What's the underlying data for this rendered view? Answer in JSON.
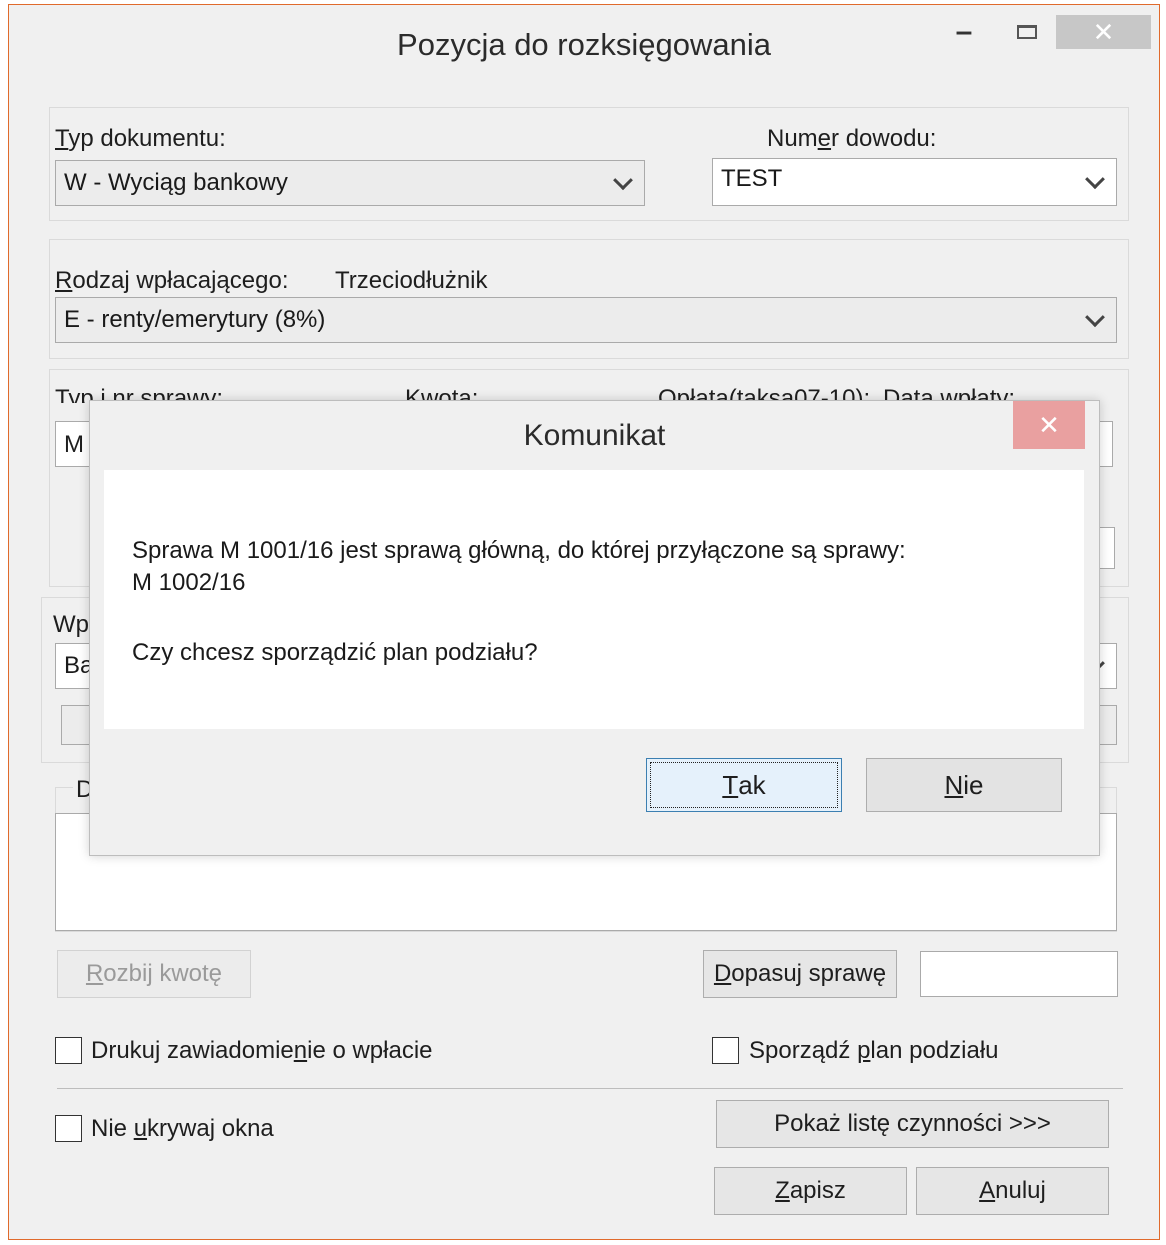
{
  "window": {
    "title": "Pozycja do rozksięgowania",
    "min_symbol": "–",
    "close_symbol": "✕"
  },
  "document": {
    "type_label_key": "T",
    "type_label_rest": "yp dokumentu:",
    "type_value": "W - Wyciąg bankowy",
    "number_label_pre": "Num",
    "number_label_key": "e",
    "number_label_post": "r dowodu:",
    "number_value": "TEST"
  },
  "payer": {
    "label_key": "R",
    "label_rest": "odzaj wpłacającego:",
    "kind": "Trzeciodłużnik",
    "value": "E   -   renty/emerytury (8%)"
  },
  "case": {
    "type_label": "Typ i nr sprawy:",
    "amount_label": "Kwota:",
    "fee_label": "Opłata(taksa07-10):",
    "date_label": "Data wpłaty:",
    "first_value": "M"
  },
  "payment": {
    "label": "Wp",
    "value": "Ba"
  },
  "description": {
    "label": "D"
  },
  "actions": {
    "split_key": "R",
    "split_rest": "ozbij kwotę",
    "match_key": "D",
    "match_rest": "opasuj sprawę"
  },
  "options": {
    "print_pre": "Drukuj zawiadomie",
    "print_key": "n",
    "print_post": "ie o wpłacie",
    "plan_pre": "Sporządź ",
    "plan_key": "p",
    "plan_post": "lan podziału",
    "keep_pre": "Nie ",
    "keep_key": "u",
    "keep_post": "krywaj okna"
  },
  "footer": {
    "show_list": "Pokaż listę czynności >>>",
    "save_key": "Z",
    "save_rest": "apisz",
    "cancel_key": "A",
    "cancel_rest": "nuluj"
  },
  "dialog": {
    "title": "Komunikat",
    "close_symbol": "✕",
    "line1": "Sprawa M 1001/16 jest sprawą główną, do której przyłączone są sprawy:",
    "line2": "M 1002/16",
    "question": "Czy chcesz sporządzić plan podziału?",
    "yes_key": "T",
    "yes_rest": "ak",
    "no_key": "N",
    "no_rest": "ie"
  }
}
